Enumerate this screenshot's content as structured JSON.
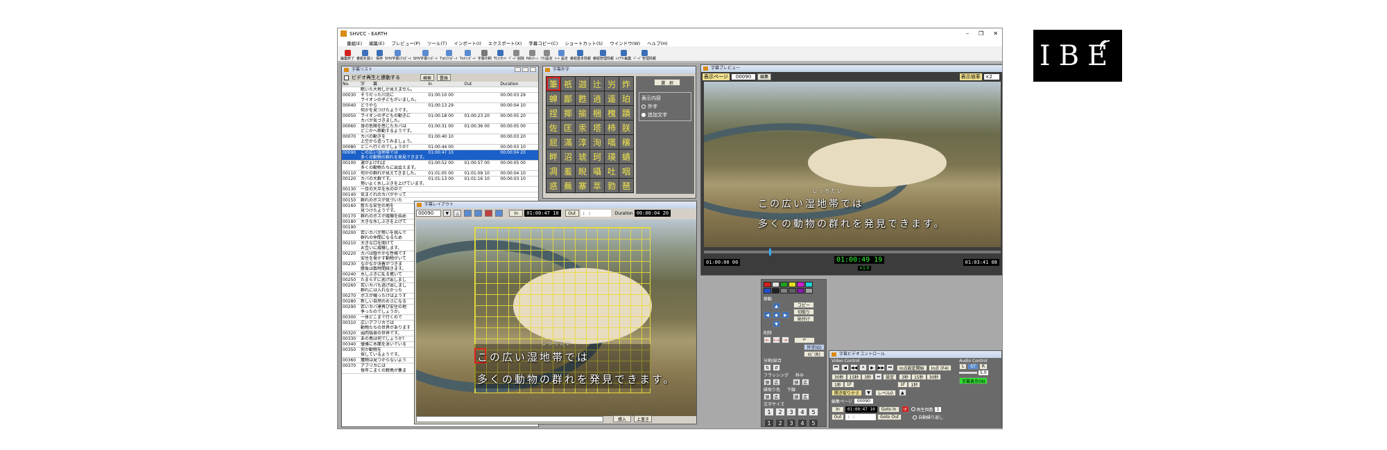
{
  "logo": {
    "text": "IBE"
  },
  "window": {
    "title": "SHVCC - EARTH",
    "controls": [
      "–",
      "❐",
      "✕"
    ]
  },
  "menu": [
    "番組(E)",
    "編集(E)",
    "プレビュー(P)",
    "ツール(T)",
    "インポート(I)",
    "エクスポート(X)",
    "字幕コピー(C)",
    "ショートカット(S)",
    "ウインドウ(W)",
    "ヘルプ(H)"
  ],
  "toolbar": [
    {
      "label": "編集終了",
      "color": "#d02020"
    },
    {
      "label": "番組を開く",
      "color": "#3a6fb8"
    },
    {
      "label": "保存",
      "color": "#3a6fb8"
    },
    {
      "label": "SHV字幕ｴｸｽﾎﾟｰﾄ",
      "color": "#5a8ad0"
    },
    {
      "label": "SHV字幕ｲﾝﾎﾟｰﾄ",
      "color": "#5a8ad0"
    },
    {
      "label": "Txtｴｸｽﾎﾟｰﾄ",
      "color": "#5a8ad0"
    },
    {
      "label": "Txtｲﾝﾎﾟｰﾄ",
      "color": "#5a8ad0"
    },
    {
      "label": "字幕印刷",
      "color": "#777"
    },
    {
      "label": "TCｵﾌｾｯﾄ",
      "color": "#3a6fb8"
    },
    {
      "label": "ﾍﾟｰｼﾞ削除",
      "color": "#888"
    },
    {
      "label": "NRｽﾂｰﾝ",
      "color": "#888"
    },
    {
      "label": "ﾏｸﾛ設定",
      "color": "#888"
    },
    {
      "label": "ｼｰﾄ 設定",
      "color": "#5a8ad0"
    },
    {
      "label": "番組基本情報",
      "color": "#3a6fb8"
    },
    {
      "label": "番組管理情報",
      "color": "#3a6fb8"
    },
    {
      "label": "ﾚｲｱｳﾄ編集",
      "color": "#3a6fb8"
    },
    {
      "label": "ﾍﾟｰｼﾞ管理情報",
      "color": "#3a6fb8"
    }
  ],
  "list_panel": {
    "title": "字幕リスト",
    "checkbox": "ビデオ再生と連動する",
    "btn_search": "検索",
    "btn_replace": "置換",
    "headers": [
      "No.",
      "字　　幕",
      "In",
      "Out",
      "Duration"
    ],
    "rows": [
      {
        "no": "",
        "text": "眠いた大地しか見えません。",
        "in": "",
        "out": "",
        "dur": ""
      },
      {
        "no": "00030",
        "text": "そうだった川沿に\nライオンの子どもがいました。",
        "in": "01:00:10 00",
        "out": "",
        "dur": "00:00:03 29"
      },
      {
        "no": "00040",
        "text": "どうやら\n何かを見つけたようです。",
        "in": "01:00:13 29",
        "out": "",
        "dur": "00:00:04 10"
      },
      {
        "no": "00050",
        "text": "ライオンの子どもの動きに\nカバが気づきました。",
        "in": "01:00:18 00",
        "out": "01:00:23 20",
        "dur": "00:00:05 20"
      },
      {
        "no": "00060",
        "text": "身の危険を感じたカバは\nどこかへ移動するようです。",
        "in": "01:00:31 00",
        "out": "01:00:36 00",
        "dur": "00:00:05 00"
      },
      {
        "no": "00070",
        "text": "カバの動きを\n上空から追ってみましょう。",
        "in": "01:00:40 10",
        "out": "",
        "dur": "00:00:03 20"
      },
      {
        "no": "00080",
        "text": "どこへ行くのでしょうか?",
        "in": "01:00:44 00",
        "out": "",
        "dur": "00:00:03 10"
      },
      {
        "no": "00090",
        "text": "この広い湿地帯では\n多くの動物の群れを発見できます。",
        "in": "01:00:47 10",
        "out": "",
        "dur": "00:00:04 20",
        "sel": true
      },
      {
        "no": "00100",
        "text": "運がよければ\n多くの動物たちに出会えます。",
        "in": "01:00:52 00",
        "out": "01:00:57 00",
        "dur": "00:00:05 00"
      },
      {
        "no": "00110",
        "text": "何かの群れが見えてきました。",
        "in": "01:01:05 00",
        "out": "01:01:09 10",
        "dur": "00:00:04 10"
      },
      {
        "no": "00120",
        "text": "カバの大群です。\n勢いよく水しぶきを上げています。",
        "in": "01:01:13 00",
        "out": "01:01:16 10",
        "dur": "00:00:03 10"
      },
      {
        "no": "00130",
        "text": "一日の大半を水の中で",
        "in": "",
        "out": "",
        "dur": ""
      },
      {
        "no": "00140",
        "text": "気まぐれのカバがやって",
        "in": "",
        "out": "",
        "dur": ""
      },
      {
        "no": "00150",
        "text": "群れのボスが気づいた",
        "in": "",
        "out": "",
        "dur": ""
      },
      {
        "no": "00160",
        "text": "新たな安住の地を\n見つけたようです。",
        "in": "",
        "out": "",
        "dur": ""
      },
      {
        "no": "00170",
        "text": "群れのボスが威嚇を始め",
        "in": "",
        "out": "",
        "dur": ""
      },
      {
        "no": "00180",
        "text": "大きな水しぶきを上げて",
        "in": "",
        "out": "",
        "dur": ""
      },
      {
        "no": "00190",
        "text": "",
        "in": "",
        "out": "",
        "dur": ""
      },
      {
        "no": "00200",
        "text": "若いカバが勢いを挑んで\n群れの仲間になるため",
        "in": "",
        "out": "",
        "dur": ""
      },
      {
        "no": "00210",
        "text": "大きな口を開けて\nお互いに威嚇します。",
        "in": "",
        "out": "",
        "dur": ""
      },
      {
        "no": "00220",
        "text": "カバは穏やかな性格です\n安住を脅かす動物がいて",
        "in": "",
        "out": "",
        "dur": ""
      },
      {
        "no": "00230",
        "text": "なかなか決着がつきま\n勝負は数時間続きます。",
        "in": "",
        "out": "",
        "dur": ""
      },
      {
        "no": "00240",
        "text": "水しぶきに乱る驚いて",
        "in": "",
        "out": "",
        "dur": ""
      },
      {
        "no": "00250",
        "text": "たまらずに逃げ出しまし",
        "in": "",
        "out": "",
        "dur": ""
      },
      {
        "no": "00260",
        "text": "若いカバも逃げ出しまし\n群れには入れなかった",
        "in": "",
        "out": "",
        "dur": ""
      },
      {
        "no": "00270",
        "text": "ボスが縄ったけはようす",
        "in": "",
        "out": "",
        "dur": ""
      },
      {
        "no": "00280",
        "text": "新しい自然のおさになる",
        "in": "",
        "out": "",
        "dur": ""
      },
      {
        "no": "00290",
        "text": "若いカバ達再び安住の地\n争ったのでしょうか。",
        "in": "",
        "out": "",
        "dur": ""
      },
      {
        "no": "00300",
        "text": "一体どこまで行くので",
        "in": "",
        "out": "",
        "dur": ""
      },
      {
        "no": "00310",
        "text": "広いアフリカでは\n動物たちの世界があります",
        "in": "",
        "out": "",
        "dur": ""
      },
      {
        "no": "00320",
        "text": "弱肉強食の世界です。",
        "in": "",
        "out": "",
        "dur": ""
      },
      {
        "no": "00330",
        "text": "あの鳥は何でしょうか?",
        "in": "",
        "out": "",
        "dur": ""
      },
      {
        "no": "00340",
        "text": "優雅に水面を泳いでいる",
        "in": "",
        "out": "",
        "dur": ""
      },
      {
        "no": "00350",
        "text": "何か動物を\n探しているようです。",
        "in": "",
        "out": "",
        "dur": ""
      },
      {
        "no": "00360",
        "text": "獲物は見つからないよう",
        "in": "",
        "out": "",
        "dur": ""
      },
      {
        "no": "00370",
        "text": "アフリカには\n毎年こまくの野鳥が集ま",
        "in": "",
        "out": "",
        "dur": ""
      }
    ]
  },
  "char_panel": {
    "title": "字幕外字",
    "chars": [
      "筆",
      "祇",
      "迦",
      "辻",
      "屶",
      "炸",
      "蝉",
      "鄙",
      "甦",
      "逍",
      "遥",
      "珀",
      "捏",
      "揶",
      "揄",
      "梱",
      "槐",
      "蹟",
      "佐",
      "匡",
      "汞",
      "塔",
      "柿",
      "朕",
      "屁",
      "滿",
      "淳",
      "洵",
      "嚆",
      "穣",
      "畔",
      "沼",
      "琥",
      "珂",
      "瑛",
      "蜻",
      "凋",
      "羞",
      "睨",
      "囁",
      "吐",
      "咽",
      "惑",
      "蕪",
      "寨",
      "萃",
      "勠",
      "琶"
    ],
    "selected": 0,
    "btn_select": "選　択",
    "display_group": "表示内容",
    "opt1": "外字",
    "opt2": "追加文字"
  },
  "layout_panel": {
    "title": "字幕レイアウト",
    "page": "00090",
    "in_label": "In",
    "in_tc": "01:00:47 10",
    "out_label": "Out",
    "out_tc": " :  :  ",
    "dur_label": "Duration",
    "dur_tc": "00:00:04 20",
    "line1": "この広い湿地帯では",
    "line2": "多くの動物の群れを発見できます。",
    "ruby": "しっちたい",
    "btn_insert": "挿入",
    "btn_overwrite": "上書き"
  },
  "preview_panel": {
    "title": "字幕プレビュー",
    "page_label": "表示ページ",
    "page": "00090",
    "btn_edit": "編集",
    "ratio_label": "表示倍率",
    "ratio": "×2",
    "line1": "この広い湿地帯では",
    "line2": "多くの動物の群れを発見できます。",
    "ruby": "しっちたい",
    "tc_start": "01:00:00 00",
    "tc_now": "01:00:49 19",
    "speed": "×1.0",
    "tc_end": "01:03:41 08",
    "seek_progress": 0.22
  },
  "tools_panel": {
    "color_label": "",
    "colors": [
      "#d02020",
      "#e0e0e0",
      "#20a020",
      "#e0e020",
      "#d020d0",
      "#20d0d0",
      "#2050d0",
      "#202020",
      "#808080",
      "#606060",
      "#8020a0",
      "#a0a0a0"
    ],
    "move_label": "移動",
    "btn_copy": "コピー",
    "btn_cut": "切取り",
    "btn_paste": "貼付け",
    "btn_hide": "外字(G)",
    "btn_ruby": "ﾙﾋﾞ(R)",
    "delete_label": "削除",
    "split_label": "分割/結合",
    "flash_label": "フラッシング",
    "frame_label": "枠み",
    "shape_label": "縁取り色",
    "low_label": "下線",
    "effect_label": "文字サイズ",
    "nums": [
      "1",
      "2",
      "3",
      "4",
      "5",
      "1",
      "2",
      "3",
      "4",
      "5"
    ],
    "narrow": "狭",
    "wide": "広"
  },
  "video_panel": {
    "title": "字幕ビデオコントロール",
    "vc_label": "Video Control",
    "ac_label": "Audio Control",
    "btn_init": "In点設定開始",
    "btn_in": "In点 (F4)",
    "btn_set": "設定",
    "steps": [
      "30秒",
      "15秒",
      "3秒",
      "1秒",
      "1F"
    ],
    "audio_btns": [
      "L",
      "ST",
      "R"
    ],
    "level": "5.0",
    "btn_subtitle": "字幕表示ON",
    "btn_open": "開き取りかさ",
    "btn_level": "レベル0",
    "edit_page_label": "編集ページ",
    "edit_page": "00090",
    "in_label": "In",
    "in_tc": "01:00:47 10",
    "goto_in": "Goto In",
    "out_label": "Out",
    "out_tc": " :  :  ",
    "goto_out": "Goto Out",
    "opt_repeat": "再生回数",
    "repeat_count": "1",
    "opt_auto": "自動繰り返し"
  }
}
